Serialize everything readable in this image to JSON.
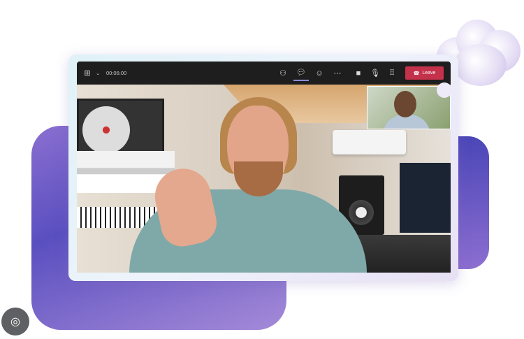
{
  "toolbar": {
    "timer": "00:06:00",
    "leave_label": "Leave",
    "icons": [
      "layout-grid-icon",
      "chevron-down-icon",
      "people-icon",
      "chat-icon",
      "reactions-icon",
      "more-icon",
      "camera-icon",
      "mic-icon",
      "share-screen-icon",
      "phone-hangup-icon"
    ]
  },
  "colors": {
    "leave": "#c4314b",
    "toolbar": "#1e1e1e",
    "accent_blob": "#6a5cc8"
  },
  "overlay": {
    "lens_icon": "google-lens-icon"
  }
}
